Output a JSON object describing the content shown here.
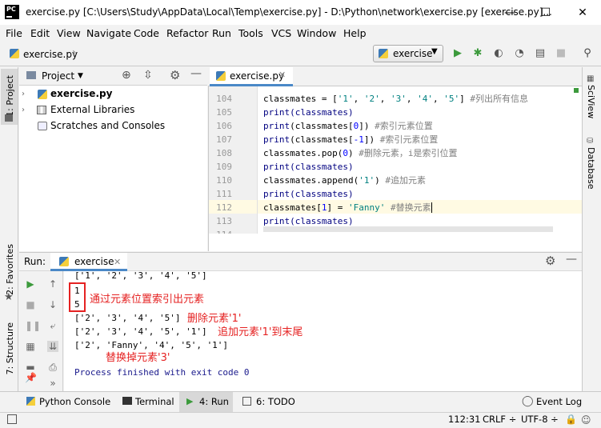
{
  "window": {
    "title": "exercise.py [C:\\Users\\Study\\AppData\\Local\\Temp\\exercise.py] - D:\\Python\\network\\exercise.py [exercise.py]...",
    "logo": "PC",
    "minimize": "—",
    "maximize": "☐",
    "close": "✕"
  },
  "menu": [
    "File",
    "Edit",
    "View",
    "Navigate",
    "Code",
    "Refactor",
    "Run",
    "Tools",
    "VCS",
    "Window",
    "Help"
  ],
  "nav": {
    "breadcrumb": "exercise.py",
    "run_config": "exercise"
  },
  "left_strip": {
    "project": "1: Project",
    "favorites": "2: Favorites",
    "structure": "7: Structure"
  },
  "right_strip": {
    "sciview": "SciView",
    "database": "Database"
  },
  "project": {
    "header": "Project",
    "items": [
      "exercise.py",
      "External Libraries",
      "Scratches and Consoles"
    ]
  },
  "editor": {
    "tab": "exercise.py",
    "lines": [
      {
        "n": "104",
        "code": "classmates = ['1', '2', '3', '4', '5']  #列出所有信息"
      },
      {
        "n": "105",
        "code": "print(classmates)"
      },
      {
        "n": "106",
        "code": "print(classmates[0])  #索引元素位置"
      },
      {
        "n": "107",
        "code": "print(classmates[-1])  #索引元素位置"
      },
      {
        "n": "108",
        "code": "classmates.pop(0)  #删除元素，i是索引位置"
      },
      {
        "n": "109",
        "code": "print(classmates)"
      },
      {
        "n": "110",
        "code": "classmates.append('1')  #追加元素"
      },
      {
        "n": "111",
        "code": "print(classmates)"
      },
      {
        "n": "112",
        "code": "classmates[1] = 'Fanny'  #替换元素"
      },
      {
        "n": "113",
        "code": "print(classmates)"
      },
      {
        "n": "114",
        "code": ""
      }
    ]
  },
  "run": {
    "label": "Run:",
    "tab": "exercise"
  },
  "console": {
    "lines": [
      "['1', '2', '3', '4', '5']",
      "1",
      "5",
      "['2', '3', '4', '5']",
      "['2', '3', '4', '5', '1']",
      "['2', 'Fanny', '4', '5', '1']",
      "",
      "Process finished with exit code 0"
    ]
  },
  "annotations": {
    "index": "通过元素位置索引出元素",
    "delete": "删除元素'1'",
    "append": "追加元素'1'到末尾",
    "replace": "替换掉元素'3'"
  },
  "bottom_tabs": {
    "python_console": "Python Console",
    "terminal": "Terminal",
    "run": "4: Run",
    "todo": "6: TODO",
    "event_log": "Event Log"
  },
  "status": {
    "position": "112:31",
    "line_sep": "CRLF ÷",
    "encoding": "UTF-8 ÷"
  },
  "colors": {
    "annotation": "#e52222",
    "run_green": "#3c9a3c",
    "tab_underline": "#4a88c7"
  }
}
